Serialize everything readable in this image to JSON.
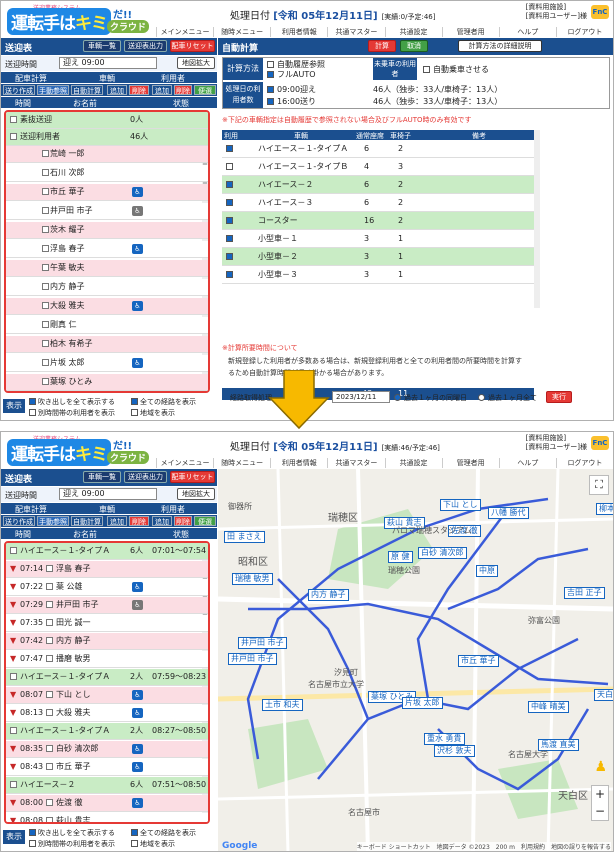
{
  "app": {
    "logo_small": "送迎業務システム",
    "logo_main": "運転手は",
    "logo_kimi": "キミ",
    "logo_da": "だ!!",
    "logo_cloud": "クラウド",
    "mini_icon": "FnC"
  },
  "header": {
    "date_label": "処理日付",
    "date_value": "[令和 05年12月11日]",
    "count_1": "[実績:0/予定:46]",
    "count_2": "[実績:46/予定:46]",
    "user_line1": "[資料用施設]",
    "user_line2": "[資料用ユーザー]様"
  },
  "menu": [
    "メインメニュー",
    "随時メニュー",
    "利用者情報",
    "共通マスター",
    "共通設定",
    "管理者用",
    "ヘルプ",
    "ログアウト"
  ],
  "left": {
    "title": "送迎表",
    "btn_list": "車輌一覧",
    "btn_output": "送迎表出力",
    "btn_reset": "配車リセット",
    "time_label": "送迎時間",
    "time_value": "迎え 09:00",
    "btn_mapexp": "地図拡大",
    "col_alloc": "配車計算",
    "col_vehicle": "車輌",
    "col_user": "利用者",
    "sub": [
      "送り作成",
      "手動参照",
      "自動計算",
      "追加",
      "削除",
      "追加",
      "削除",
      "便選択"
    ],
    "col_time": "時間",
    "col_name": "お名前",
    "col_state": "状態"
  },
  "list1": {
    "groups": [
      {
        "name": "素抜送迎",
        "count": "0人"
      },
      {
        "name": "送迎利用者",
        "count": "46人"
      }
    ],
    "people": [
      "荒崎 一郎",
      "石川 次郎",
      "市丘 華子",
      "井戸田 市子",
      "茨木 耀子",
      "浮島 春子",
      "午葉 敏夫",
      "内方 静子",
      "大殺 雅夫",
      "剛真 仁",
      "柏木 有希子",
      "片坂 太郎",
      "葉塚 ひとみ",
      "神港 伸二"
    ]
  },
  "list2": {
    "groups": [
      {
        "name": "ハイエース－１-タイプＡ",
        "count": "6人",
        "span": "07:01～07:54"
      },
      {
        "name": "ハイエース－１-タイプＡ",
        "count": "2人",
        "span": "07:59～08:23"
      },
      {
        "name": "ハイエース－１-タイプＡ",
        "count": "2人",
        "span": "08:27～08:50"
      },
      {
        "name": "ハイエース－２",
        "count": "6人",
        "span": "07:51～08:50"
      }
    ],
    "rows": [
      {
        "t": "07:14",
        "n": "浮島 春子"
      },
      {
        "t": "07:22",
        "n": "薬 公雄"
      },
      {
        "t": "07:29",
        "n": "井戸田 市子"
      },
      {
        "t": "07:35",
        "n": "田光 誠一"
      },
      {
        "t": "07:42",
        "n": "内方 静子"
      },
      {
        "t": "07:47",
        "n": "播磨 敏男"
      },
      {
        "t": "08:07",
        "n": "下山 とし"
      },
      {
        "t": "08:13",
        "n": "大殺 雅夫"
      },
      {
        "t": "08:35",
        "n": "白砂 清次郎"
      },
      {
        "t": "08:43",
        "n": "市丘 華子"
      },
      {
        "t": "08:00",
        "n": "佐渡 徹"
      },
      {
        "t": "08:08",
        "n": "萩山 貴志"
      }
    ]
  },
  "footer": {
    "display": "表示",
    "opt1": "吹き出しを全て表示する",
    "opt2": "全ての経路を表示",
    "opt3": "別時間帯の利用者を表示",
    "opt4": "地域を表示"
  },
  "right": {
    "title": "自動計算",
    "btn_calc": "計算",
    "btn_cancel": "取消",
    "btn_detail": "計算方法の詳細説明",
    "method_label": "計算方法",
    "opt_history": "自動履歴参照",
    "opt_fullauto": "フルAUTO",
    "unassigned_label": "未乗車の利用者",
    "opt_autoride": "自動乗車させる",
    "users_label": "処理日の利用者数",
    "trip1": "09:00迎え",
    "trip1_detail": "46人（独歩：33人/車椅子：13人）",
    "trip2": "16:00送り",
    "trip2_detail": "46人（独歩：33人/車椅子：13人）",
    "notice": "※下記の車輌指定は自動履歴で参照されない場合及びフルAUTO時のみ有効です",
    "th": [
      "利用",
      "車輌",
      "通常座席",
      "車椅子",
      "備考"
    ],
    "vehicles": [
      {
        "name": "ハイエース－１-タイプＡ",
        "seat": "6",
        "wc": "2",
        "on": true,
        "g": false
      },
      {
        "name": "ハイエース－１-タイプＢ",
        "seat": "4",
        "wc": "3",
        "on": false,
        "g": false
      },
      {
        "name": "ハイエース－２",
        "seat": "6",
        "wc": "2",
        "on": true,
        "g": true
      },
      {
        "name": "ハイエース－３",
        "seat": "6",
        "wc": "2",
        "on": true,
        "g": false
      },
      {
        "name": "コースター",
        "seat": "16",
        "wc": "2",
        "on": true,
        "g": true
      },
      {
        "name": "小型車－１",
        "seat": "3",
        "wc": "1",
        "on": true,
        "g": false
      },
      {
        "name": "小型車－２",
        "seat": "3",
        "wc": "1",
        "on": true,
        "g": true
      },
      {
        "name": "小型車－３",
        "seat": "3",
        "wc": "1",
        "on": true,
        "g": false
      }
    ],
    "total_label": "合計",
    "total_seat": "43",
    "total_wc": "11",
    "note_head": "※計算所要時間について",
    "note_body": "新規登録した利用者が多数ある場合は、新規登録利用者と全ての利用者間の所要時間を計算するため自動計算時間が長く掛かる場合があります。",
    "route_label": "経路取得処理",
    "route_date": "2023/12/11",
    "radio1": "過去１ヶ月の同曜日",
    "radio2": "過去１ヶ月全て",
    "btn_run": "実行"
  },
  "map": {
    "labels": [
      "萩山 貴志",
      "下山 とし",
      "田 まさえ",
      "八幡 勝代",
      "柳本 有",
      "吉田 正子",
      "瑞穂 敏男",
      "白砂 清次郎",
      "内方 静子",
      "井戸田 市子",
      "中原",
      "井戸田 市子",
      "市丘 華子",
      "土市 和夫",
      "原 健",
      "中峰 晴美",
      "薬塚 ひとみ",
      "片坂 太郎",
      "重水 勇貴",
      "沢杉 敦夫",
      "佐渡 徹",
      "馬渡 直美",
      "天白"
    ],
    "places": [
      "パロマ瑞穂スタジアム",
      "瑞穂公園",
      "名古屋市立大学",
      "名古屋大学",
      "弥富公園",
      "汐見町",
      "瑞穂区",
      "昭和区",
      "御器所",
      "天白区",
      "名古屋市"
    ],
    "google": "Google",
    "footer": "キーボード ショートカット　地図データ ©2023　200 m　利用規約　地図の誤りを報告する"
  }
}
